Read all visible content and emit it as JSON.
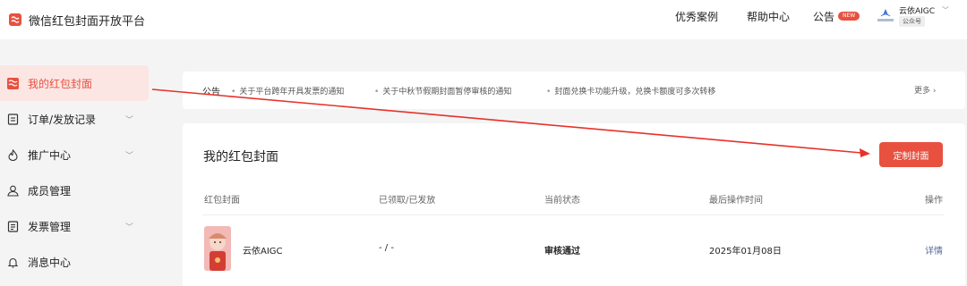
{
  "header": {
    "app_title": "微信红包封面开放平台",
    "nav": {
      "cases": "优秀案例",
      "help": "帮助中心",
      "notice": "公告",
      "new_badge": "NEW"
    },
    "account": {
      "name": "云依AIGC",
      "type": "公众号",
      "logo_text": "云依AIGC"
    }
  },
  "sidebar": {
    "items": [
      {
        "label": "我的红包封面",
        "icon": "red-packet-icon",
        "active": true
      },
      {
        "label": "订单/发放记录",
        "icon": "order-list-icon",
        "expandable": true
      },
      {
        "label": "推广中心",
        "icon": "promotion-icon",
        "expandable": true
      },
      {
        "label": "成员管理",
        "icon": "members-icon"
      },
      {
        "label": "发票管理",
        "icon": "invoice-icon",
        "expandable": true
      },
      {
        "label": "消息中心",
        "icon": "bell-icon"
      }
    ]
  },
  "notices": {
    "title": "公告",
    "items": [
      "关于平台跨年开具发票的通知",
      "关于中秋节假期封面暂停审核的通知",
      "封面兑换卡功能升级，兑换卡额度可多次转移"
    ],
    "more": "更多"
  },
  "main": {
    "title": "我的红包封面",
    "custom_button": "定制封面",
    "columns": [
      "红包封面",
      "已领取/已发放",
      "当前状态",
      "最后操作时间",
      "操作"
    ],
    "rows": [
      {
        "name": "云依AIGC",
        "claimed": "- / -",
        "status": "审核通过",
        "last_time": "2025年01月08日",
        "action": "详情"
      }
    ]
  },
  "colors": {
    "accent": "#e8513f",
    "active_bg": "#fbe6e4",
    "link": "#576b95",
    "page_bg": "#f4f4f5"
  }
}
